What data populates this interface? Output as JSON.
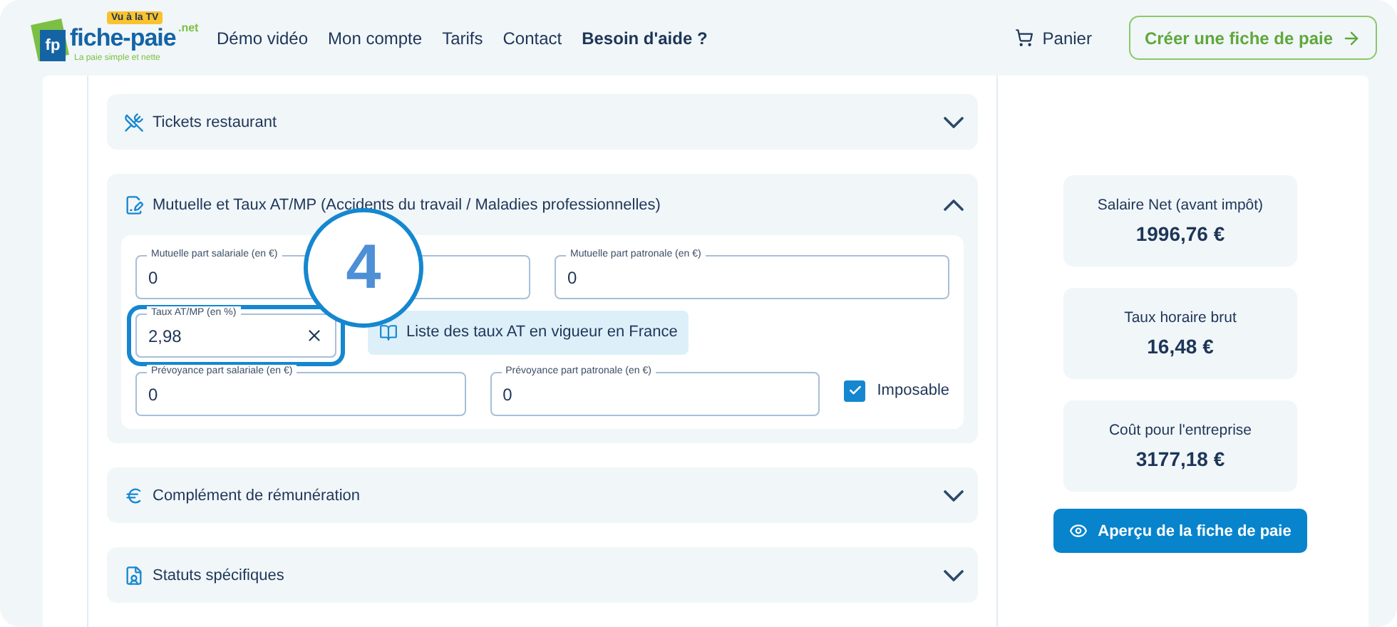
{
  "header": {
    "logo": {
      "mark": "fp",
      "name": "fiche-paie",
      "suffix": ".net",
      "badge": "Vu à la TV",
      "tagline": "La paie simple et nette"
    },
    "nav": [
      {
        "label": "Démo vidéo",
        "emphasis": false
      },
      {
        "label": "Mon compte",
        "emphasis": false
      },
      {
        "label": "Tarifs",
        "emphasis": false
      },
      {
        "label": "Contact",
        "emphasis": false
      },
      {
        "label": "Besoin d'aide ?",
        "emphasis": true
      }
    ],
    "cart": "Panier",
    "cta": "Créer une fiche de paie"
  },
  "sections": [
    {
      "title": "Tickets restaurant",
      "expanded": false
    },
    {
      "title": "Mutuelle et Taux AT/MP (Accidents du travail / Maladies professionnelles)",
      "expanded": true,
      "rows": [
        [
          {
            "kind": "field",
            "label": "Mutuelle part salariale (en €)",
            "value": "0",
            "clearable": false,
            "highlighted": false
          },
          {
            "kind": "field",
            "label": "Mutuelle part patronale (en €)",
            "value": "0",
            "clearable": false,
            "highlighted": false
          }
        ],
        [
          {
            "kind": "field",
            "label": "Taux AT/MP (en %)",
            "value": "2,98",
            "clearable": true,
            "highlighted": true
          },
          {
            "kind": "link",
            "label": "Liste des taux AT en vigueur en France"
          }
        ],
        [
          {
            "kind": "field",
            "label": "Prévoyance part salariale (en €)",
            "value": "0",
            "clearable": false,
            "highlighted": false
          },
          {
            "kind": "field",
            "label": "Prévoyance part patronale (en €)",
            "value": "0",
            "clearable": false,
            "highlighted": false
          },
          {
            "kind": "checkbox",
            "label": "Imposable",
            "checked": true
          }
        ]
      ]
    },
    {
      "title": "Complément de rémunération",
      "expanded": false
    },
    {
      "title": "Statuts spécifiques",
      "expanded": false
    }
  ],
  "step_badge": "4",
  "summary": [
    {
      "label": "Salaire Net (avant impôt)",
      "value": "1996,76 €"
    },
    {
      "label": "Taux horaire brut",
      "value": "16,48 €"
    },
    {
      "label": "Coût pour l'entreprise",
      "value": "3177,18 €"
    }
  ],
  "preview_button": "Aperçu de la fiche de paie"
}
